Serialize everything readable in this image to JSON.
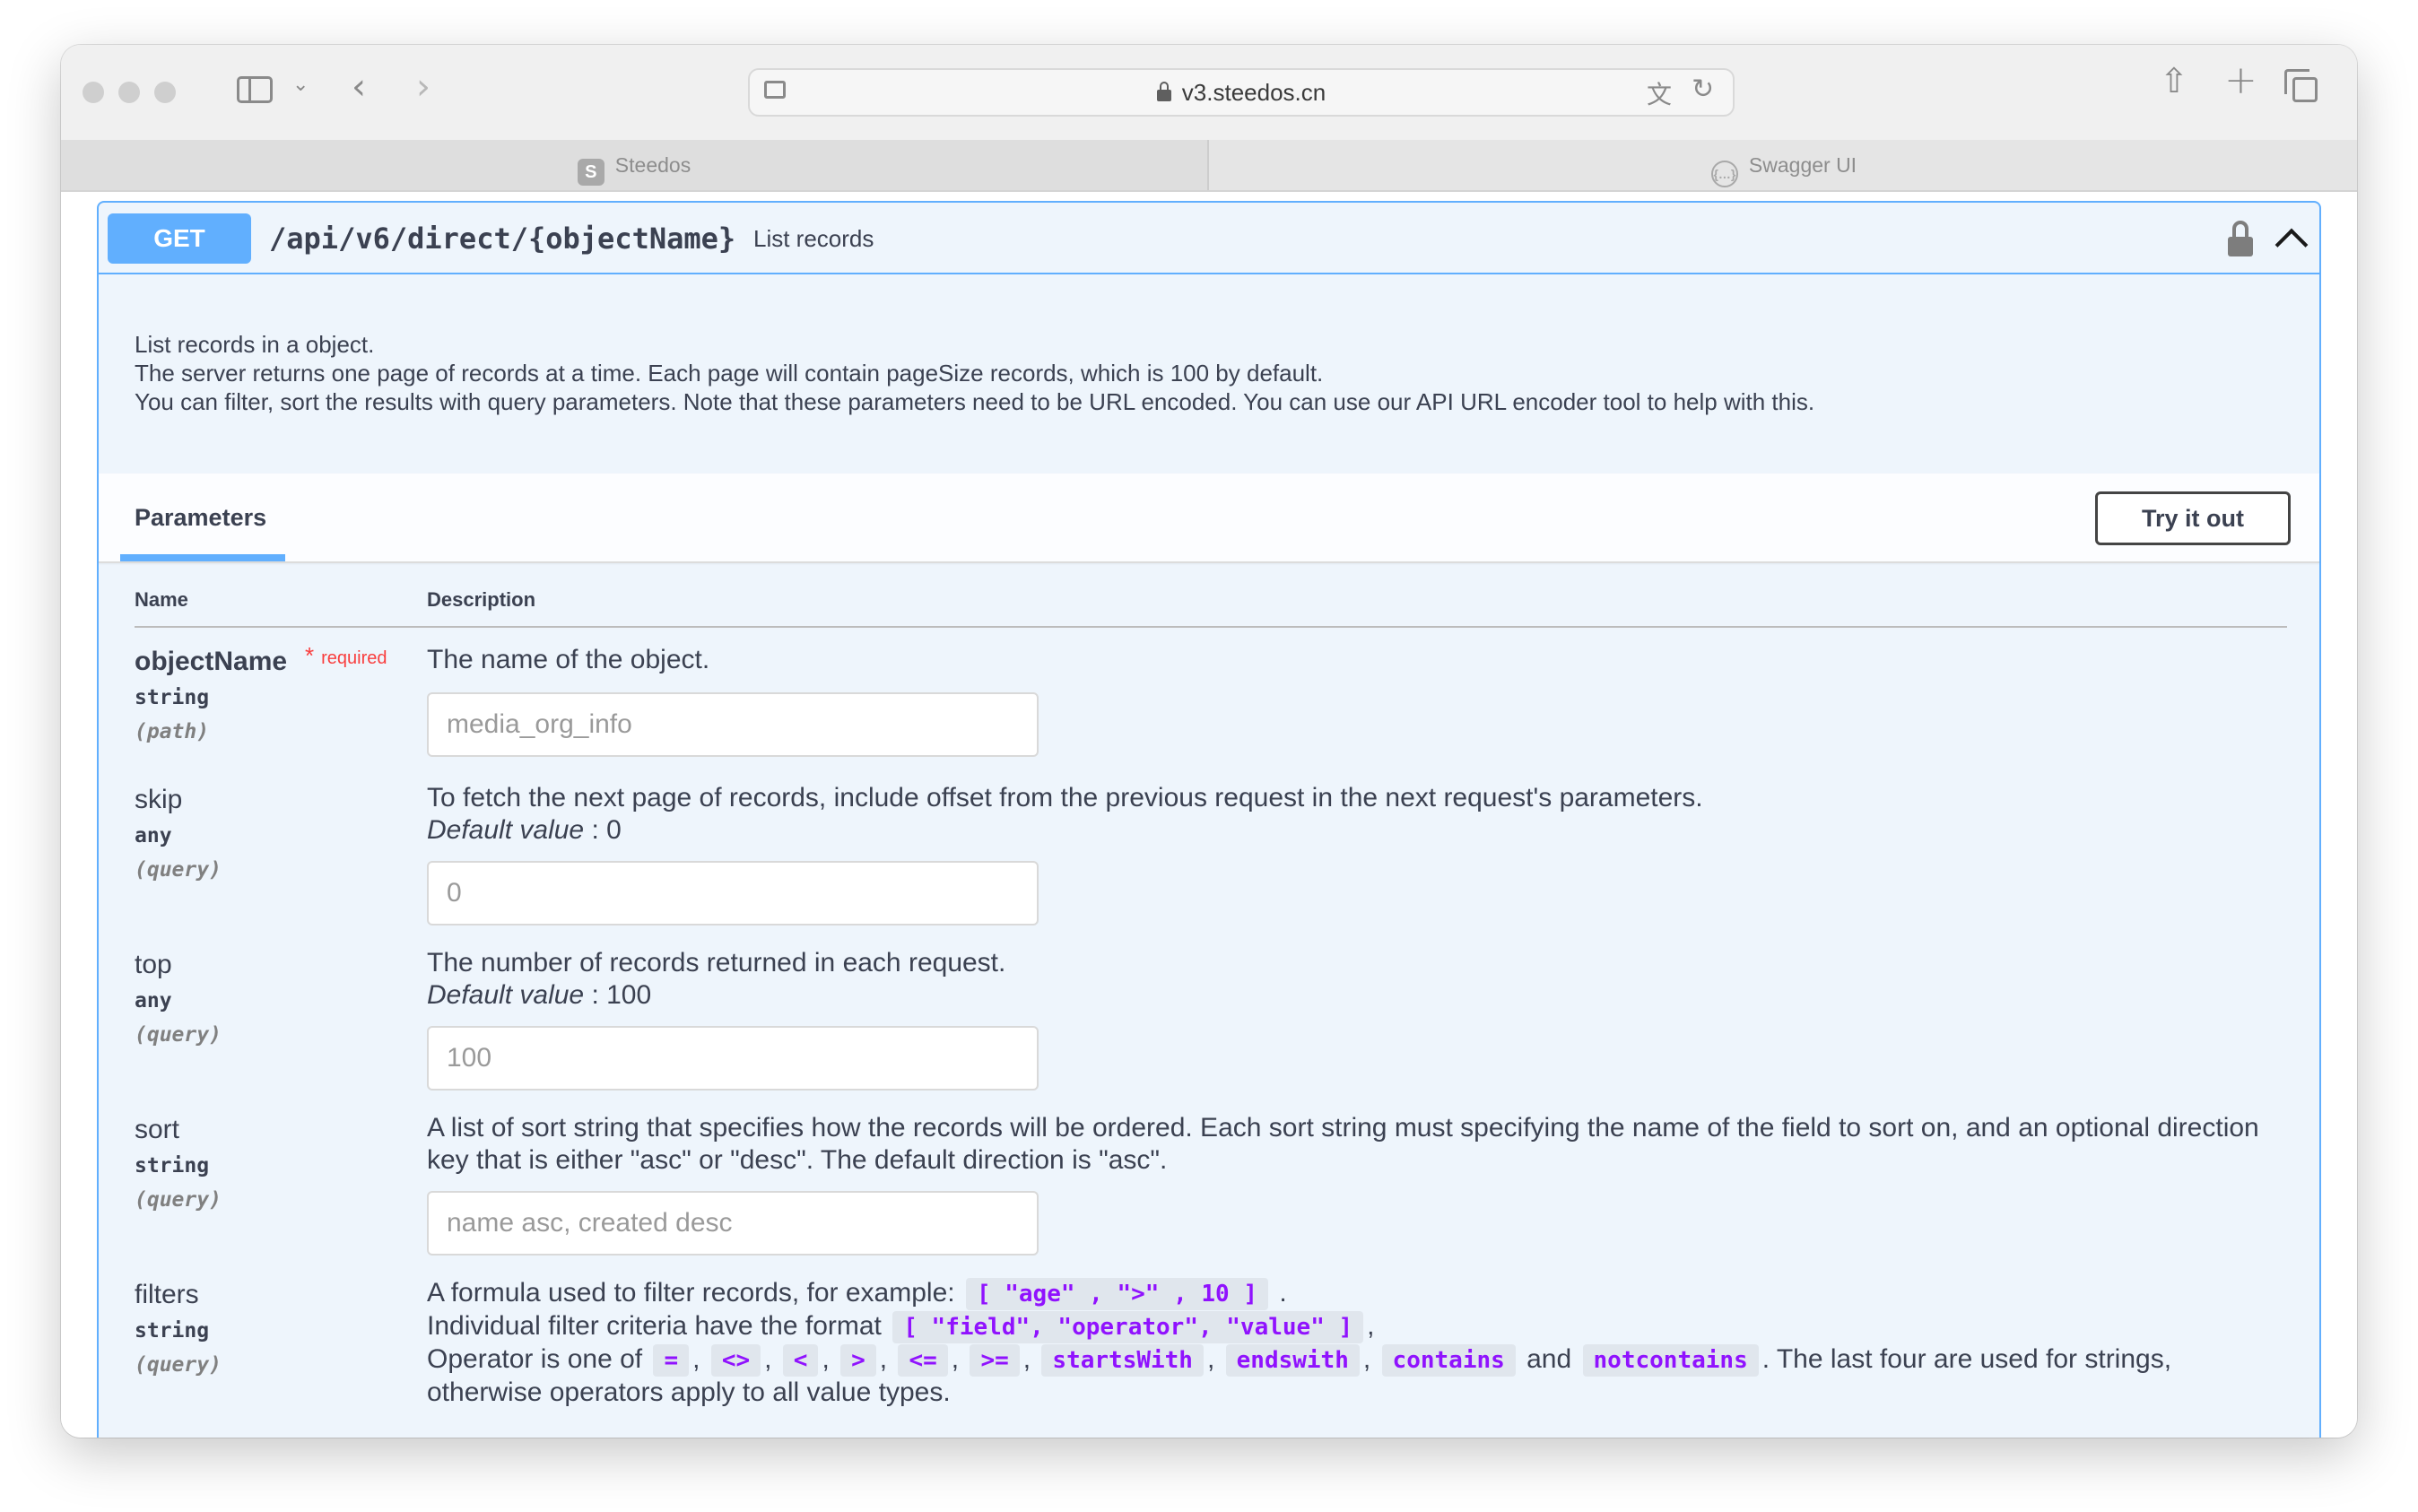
{
  "browser": {
    "url": "v3.steedos.cn",
    "tabs": [
      {
        "label": "Steedos",
        "favicon": "S"
      },
      {
        "label": "Swagger UI"
      }
    ]
  },
  "operation": {
    "method": "GET",
    "path": "/api/v6/direct/{objectName}",
    "summary": "List records",
    "description": [
      "List records in a object.",
      "The server returns one page of records at a time. Each page will contain pageSize records, which is 100 by default.",
      "You can filter, sort the results with query parameters. Note that these parameters need to be URL encoded. You can use our API URL encoder tool to help with this."
    ]
  },
  "parameters_section": {
    "tab_label": "Parameters",
    "try_button": "Try it out",
    "col_name": "Name",
    "col_description": "Description",
    "required_label": "required",
    "required_star": "*",
    "default_label": "Default value",
    "default_sep": " : "
  },
  "params": [
    {
      "name": "objectName",
      "type": "string",
      "in": "(path)",
      "description": "The name of the object.",
      "placeholder": "media_org_info"
    },
    {
      "name": "skip",
      "type": "any",
      "in": "(query)",
      "description": "To fetch the next page of records, include offset from the previous request in the next request's parameters.",
      "default": "0",
      "placeholder": "0"
    },
    {
      "name": "top",
      "type": "any",
      "in": "(query)",
      "description": "The number of records returned in each request.",
      "default": "100",
      "placeholder": "100"
    },
    {
      "name": "sort",
      "type": "string",
      "in": "(query)",
      "description": "A list of sort string that specifies how the records will be ordered. Each sort string must specifying the name of the field to sort on, and an optional direction key that is either \"asc\" or \"desc\". The default direction is \"asc\".",
      "placeholder": "name asc, created desc"
    },
    {
      "name": "filters",
      "type": "string",
      "in": "(query)",
      "line1_prefix": "A formula used to filter records, for example:",
      "line1_code": "[ \"age\" , \">\" , 10 ]",
      "line1_suffix": ".",
      "line2_prefix": "Individual filter criteria have the format",
      "line2_code": "[ \"field\", \"operator\", \"value\" ]",
      "line2_suffix": ",",
      "line3_prefix": "Operator is one of",
      "operators": [
        "=",
        "<>",
        "<",
        ">",
        "<=",
        ">=",
        "startsWith",
        "endswith",
        "contains"
      ],
      "and_word": "and",
      "last_operator": "notcontains",
      "line3_suffix": ". The last four are used for strings,",
      "line4": "otherwise operators apply to all value types."
    }
  ],
  "colors": {
    "get": "#61affe",
    "required": "#f93e3e",
    "code": "#9012fe"
  }
}
